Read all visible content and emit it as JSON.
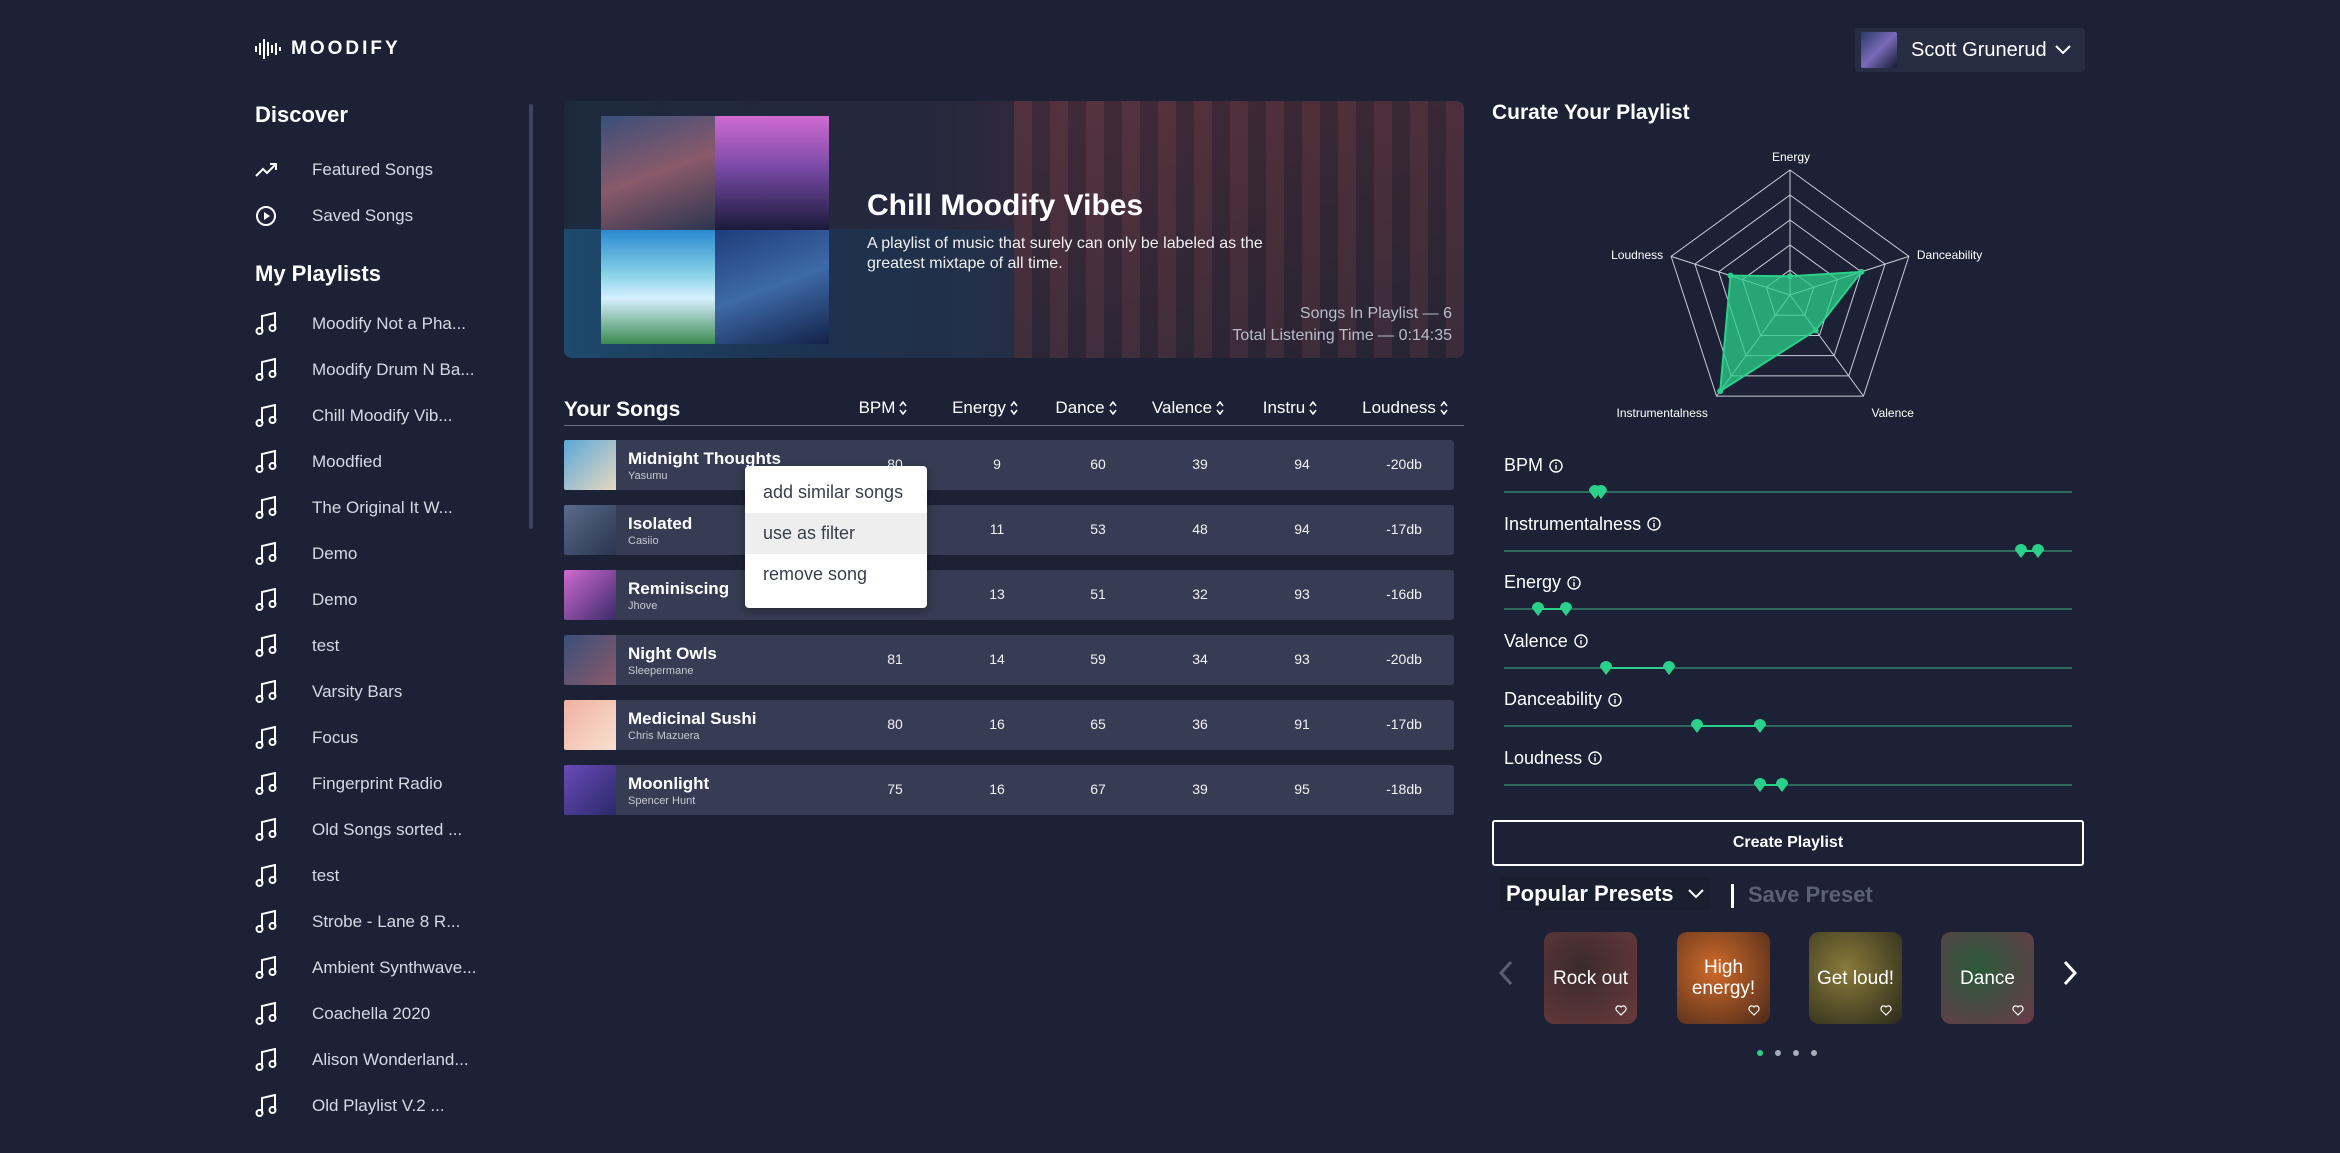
{
  "app": {
    "name": "MOODIFY"
  },
  "user": {
    "name": "Scott Grunerud"
  },
  "sidebar": {
    "discover_heading": "Discover",
    "discover_items": [
      {
        "label": "Featured Songs",
        "icon": "trending-up-icon"
      },
      {
        "label": "Saved Songs",
        "icon": "saved-songs-icon"
      }
    ],
    "playlists_heading": "My Playlists",
    "playlists": [
      "Moodify Not a Pha...",
      "Moodify Drum N Ba...",
      "Chill Moodify Vib...",
      "Moodfied",
      "The Original It W...",
      "Demo",
      "Demo",
      "test",
      "Varsity Bars",
      "Focus",
      "Fingerprint Radio",
      "Old Songs sorted ...",
      "test",
      "Strobe - Lane 8 R...",
      "Ambient Synthwave...",
      "Coachella 2020",
      "Alison Wonderland...",
      "Old Playlist V.2 ..."
    ]
  },
  "banner": {
    "title": "Chill Moodify Vibes",
    "description": "A playlist of music that surely can only be labeled as the greatest mixtape of all time.",
    "songs_count": "Songs In Playlist — 6",
    "listening_time": "Total Listening Time — 0:14:35"
  },
  "songs": {
    "title": "Your Songs",
    "columns": [
      "BPM",
      "Energy",
      "Dance",
      "Valence",
      "Instru",
      "Loudness"
    ],
    "rows": [
      {
        "name": "Midnight Thoughts",
        "artist": "Yasumu",
        "bpm": "80",
        "energy": "9",
        "dance": "60",
        "valence": "39",
        "instru": "94",
        "loudness": "-20db",
        "thumb": [
          "#5aa8d8",
          "#e8d8c0"
        ]
      },
      {
        "name": "Isolated",
        "artist": "Casiio",
        "bpm": "",
        "energy": "11",
        "dance": "53",
        "valence": "48",
        "instru": "94",
        "loudness": "-17db",
        "thumb": [
          "#5a6a8a",
          "#2a3550"
        ]
      },
      {
        "name": "Reminiscing",
        "artist": "Jhove",
        "bpm": "",
        "energy": "13",
        "dance": "51",
        "valence": "32",
        "instru": "93",
        "loudness": "-16db",
        "thumb": [
          "#d06ad0",
          "#3a2a6a"
        ]
      },
      {
        "name": "Night Owls",
        "artist": "Sleepermane",
        "bpm": "81",
        "energy": "14",
        "dance": "59",
        "valence": "34",
        "instru": "93",
        "loudness": "-20db",
        "thumb": [
          "#3a4f7a",
          "#8a5a6a"
        ]
      },
      {
        "name": "Medicinal Sushi",
        "artist": "Chris Mazuera",
        "bpm": "80",
        "energy": "16",
        "dance": "65",
        "valence": "36",
        "instru": "91",
        "loudness": "-17db",
        "thumb": [
          "#f0b0a0",
          "#f8e0d0"
        ]
      },
      {
        "name": "Moonlight",
        "artist": "Spencer Hunt",
        "bpm": "75",
        "energy": "16",
        "dance": "67",
        "valence": "39",
        "instru": "95",
        "loudness": "-18db",
        "thumb": [
          "#6a4ab8",
          "#2a2a6a"
        ]
      }
    ]
  },
  "context_menu": {
    "items": [
      "add similar songs",
      "use as filter",
      "remove song"
    ]
  },
  "curate": {
    "title": "Curate Your Playlist",
    "radar_labels": [
      "Energy",
      "Danceability",
      "Valence",
      "Instrumentalness",
      "Loudness"
    ],
    "radar_values": [
      0.15,
      0.6,
      0.35,
      0.95,
      0.5
    ],
    "sliders": [
      {
        "label": "BPM",
        "low": 0.16,
        "high": 0.17
      },
      {
        "label": "Instrumentalness",
        "low": 0.91,
        "high": 0.94
      },
      {
        "label": "Energy",
        "low": 0.06,
        "high": 0.11
      },
      {
        "label": "Valence",
        "low": 0.18,
        "high": 0.29
      },
      {
        "label": "Danceability",
        "low": 0.34,
        "high": 0.45
      },
      {
        "label": "Loudness",
        "low": 0.45,
        "high": 0.49
      }
    ],
    "create_button": "Create Playlist"
  },
  "presets": {
    "selected": "Popular Presets",
    "save_label": "Save Preset",
    "cards": [
      {
        "name": "Rock out",
        "colors": [
          "#3a2a2e",
          "#6a3a3a"
        ]
      },
      {
        "name": "High energy!",
        "colors": [
          "#d06a2a",
          "#4a2a1a"
        ]
      },
      {
        "name": "Get loud!",
        "colors": [
          "#8a7a3a",
          "#2a2a1a"
        ]
      },
      {
        "name": "Dance",
        "colors": [
          "#2a5a3a",
          "#6a3a4a"
        ]
      }
    ],
    "page_count": 4,
    "active_page": 0
  },
  "colors": {
    "accent": "#2bd18b",
    "background": "#1c2135",
    "row": "#363c53"
  }
}
